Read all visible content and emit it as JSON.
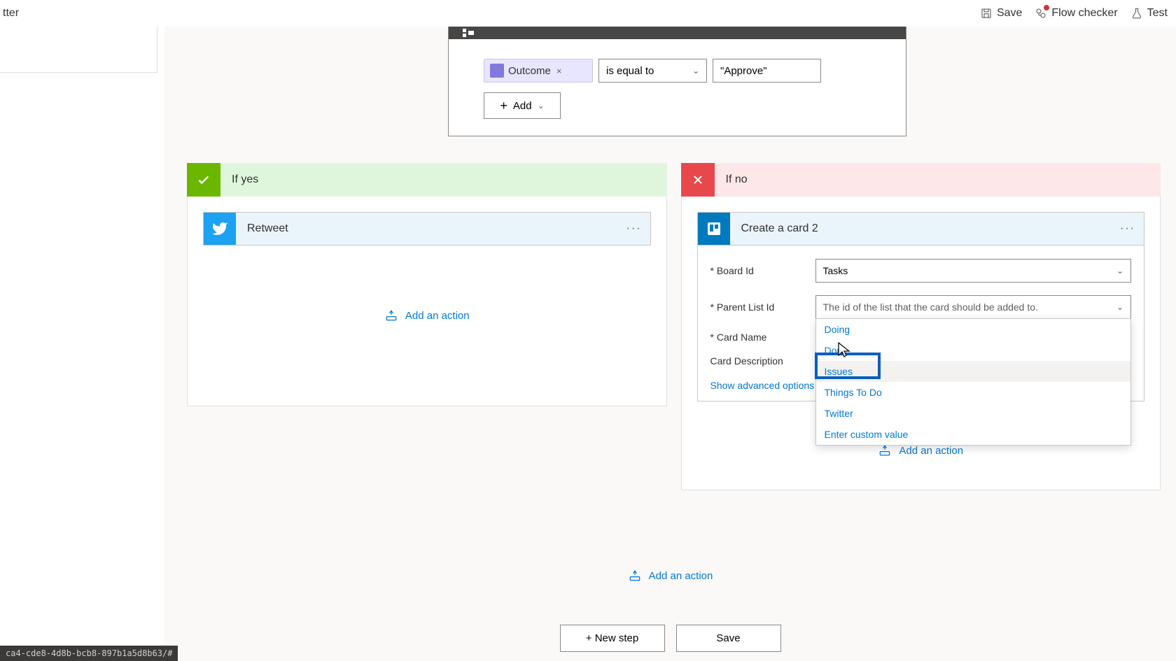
{
  "topbar": {
    "title_fragment": "tter",
    "save": "Save",
    "flow_checker": "Flow checker",
    "test": "Test"
  },
  "condition": {
    "token_label": "Outcome",
    "operator": "is equal to",
    "value": "\"Approve\"",
    "add": "Add"
  },
  "branch_yes": {
    "title": "If yes",
    "action_title": "Retweet",
    "add_action": "Add an action"
  },
  "branch_no": {
    "title": "If no",
    "action_title": "Create a card 2",
    "params": {
      "board_label": "Board Id",
      "board_value": "Tasks",
      "list_label": "Parent List Id",
      "list_placeholder": "The id of the list that the card should be added to.",
      "name_label": "Card Name",
      "desc_label": "Card Description"
    },
    "dropdown": [
      "Doing",
      "Done",
      "Issues",
      "Things To Do",
      "Twitter",
      "Enter custom value"
    ],
    "advanced": "Show advanced options",
    "add_action": "Add an action"
  },
  "outer": {
    "add_action": "Add an action",
    "new_step": "+ New step",
    "save": "Save"
  },
  "status": "ca4-cde8-4d8b-bcb8-897b1a5d8b63/#"
}
